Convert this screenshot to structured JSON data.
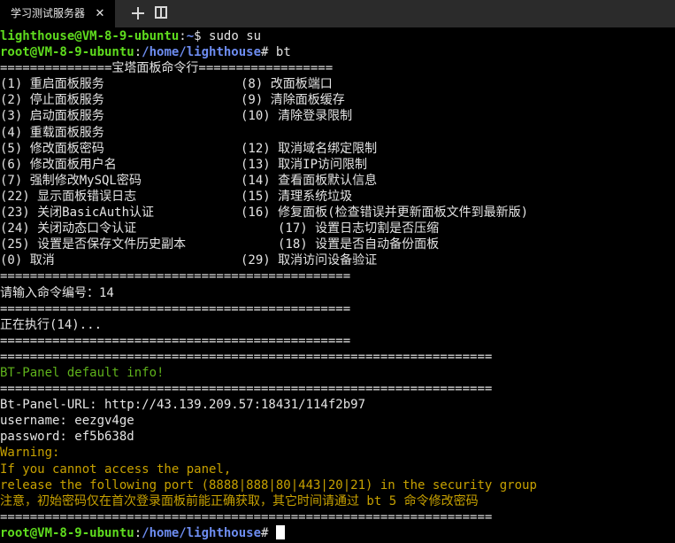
{
  "window": {
    "tab_title": "学习测试服务器",
    "close_glyph": "✕"
  },
  "terminal": {
    "prompt1": {
      "userhost": "lighthouse@VM-8-9-ubuntu",
      "sep": ":",
      "path": "~",
      "symbol": "$",
      "command": "sudo su"
    },
    "prompt2": {
      "userhost": "root@VM-8-9-ubuntu",
      "sep": ":",
      "path": "/home/lighthouse",
      "symbol": "#",
      "command": "bt"
    },
    "menu_header": "===============宝塔面板命令行==================",
    "menu_rows": [
      {
        "left": "(1) 重启面板服务",
        "right": "(8) 改面板端口"
      },
      {
        "left": "(2) 停止面板服务",
        "right": "(9) 清除面板缓存"
      },
      {
        "left": "(3) 启动面板服务",
        "right": "(10) 清除登录限制"
      },
      {
        "left": "(4) 重载面板服务",
        "right": ""
      },
      {
        "left": "(5) 修改面板密码",
        "right": "(12) 取消域名绑定限制"
      },
      {
        "left": "(6) 修改面板用户名",
        "right": "(13) 取消IP访问限制"
      },
      {
        "left": "(7) 强制修改MySQL密码",
        "right": "(14) 查看面板默认信息"
      },
      {
        "left": "(22) 显示面板错误日志",
        "right": "(15) 清理系统垃圾"
      },
      {
        "left": "(23) 关闭BasicAuth认证",
        "right": "(16) 修复面板(检查错误并更新面板文件到最新版)"
      },
      {
        "left": "(24) 关闭动态口令认证",
        "right": "(17) 设置日志切割是否压缩"
      },
      {
        "left": "(25) 设置是否保存文件历史副本",
        "right": "(18) 设置是否自动备份面板"
      },
      {
        "left": "(0) 取消",
        "right": "(29) 取消访问设备验证"
      }
    ],
    "separator_short": "===============================================",
    "input_prompt": "请输入命令编号：14",
    "executing": "正在执行(14)...",
    "separator_long": "==================================================================",
    "info_title": "BT-Panel default info!",
    "panel_url": "Bt-Panel-URL: http://43.139.209.57:18431/114f2b97",
    "username": "username: eezgv4ge",
    "password": "password: ef5b638d",
    "warning_title": "Warning:",
    "warning_line1": "If you cannot access the panel,",
    "warning_line2": "release the following port (8888|888|80|443|20|21) in the security group",
    "notice": "注意，初始密码仅在首次登录面板前能正确获取，其它时间请通过 bt 5 命令修改密码",
    "prompt3": {
      "userhost": "root@VM-8-9-ubuntu",
      "sep": ":",
      "path": "/home/lighthouse",
      "symbol": "#"
    }
  }
}
